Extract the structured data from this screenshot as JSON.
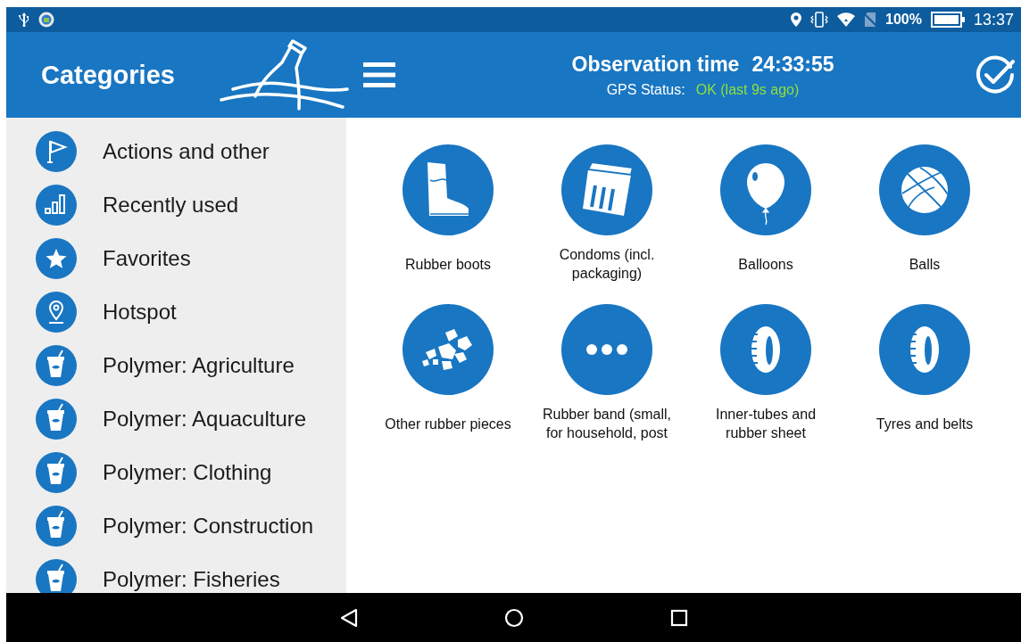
{
  "status_bar": {
    "battery_text": "100%",
    "time": "13:37"
  },
  "header": {
    "title": "Categories",
    "observation_label": "Observation time",
    "observation_time": "24:33:55",
    "gps_label": "GPS Status:",
    "gps_value": "OK (last 9s ago)",
    "gps_ok": true
  },
  "sidebar": {
    "items": [
      {
        "label": "Actions and other",
        "kind": "flag"
      },
      {
        "label": "Recently used",
        "kind": "bars"
      },
      {
        "label": "Favorites",
        "kind": "star"
      },
      {
        "label": "Hotspot",
        "kind": "pin"
      },
      {
        "label": "Polymer: Agriculture",
        "kind": "cup"
      },
      {
        "label": "Polymer: Aquaculture",
        "kind": "cup"
      },
      {
        "label": "Polymer: Clothing",
        "kind": "cup"
      },
      {
        "label": "Polymer: Construction",
        "kind": "cup"
      },
      {
        "label": "Polymer: Fisheries",
        "kind": "cup"
      }
    ]
  },
  "categories": [
    {
      "label": "Rubber boots",
      "kind": "boot"
    },
    {
      "label": "Condoms (incl.\npackaging)",
      "kind": "box"
    },
    {
      "label": "Balloons",
      "kind": "balloon"
    },
    {
      "label": "Balls",
      "kind": "ball"
    },
    {
      "label": "Other rubber pieces",
      "kind": "pieces"
    },
    {
      "label": "Rubber band (small,\nfor household, post",
      "kind": "dots"
    },
    {
      "label": "Inner-tubes and\nrubber sheet",
      "kind": "tyre"
    },
    {
      "label": "Tyres and belts",
      "kind": "tyre"
    }
  ]
}
